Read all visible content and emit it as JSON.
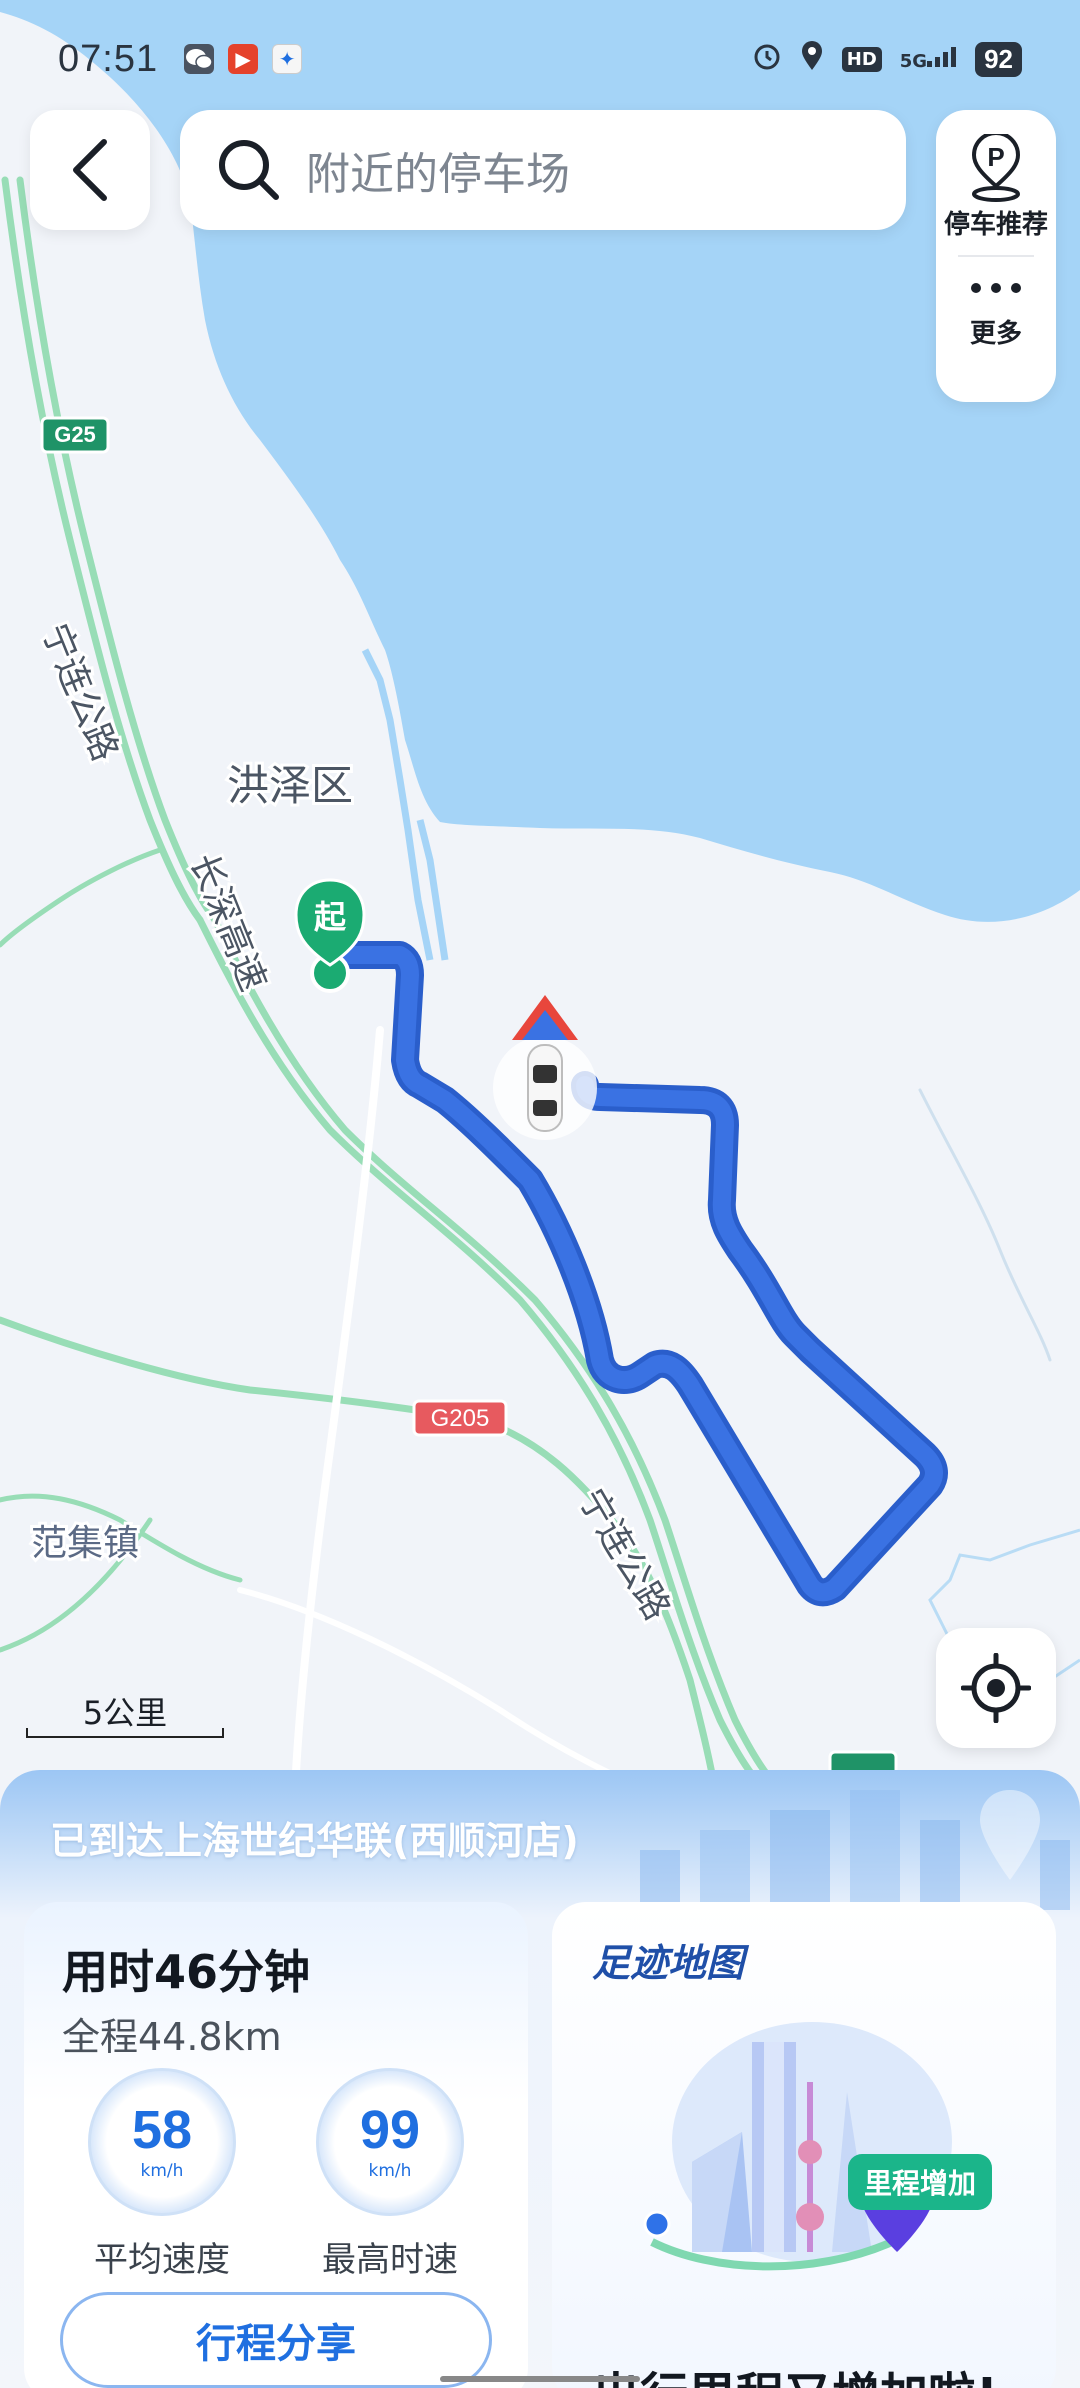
{
  "status_bar": {
    "time": "07:51",
    "hd": "HD",
    "network": "5G",
    "battery": "92"
  },
  "search": {
    "placeholder": "附近的停车场"
  },
  "right_panel": {
    "parking_label": "停车推荐",
    "more_label": "更多"
  },
  "map": {
    "labels": {
      "district": "洪泽区",
      "town": "范集镇",
      "road_ninglian_1": "宁连公路",
      "road_changshen": "长深高速",
      "road_ninglian_2": "宁连公路"
    },
    "shields": {
      "g25": "G25",
      "g205": "G205",
      "bottom": "G205"
    },
    "start_marker": "起",
    "scale_label": "5公里"
  },
  "trip": {
    "arrival_text": "已到达上海世纪华联(西顺河店)",
    "duration": "用时46分钟",
    "distance": "全程44.8km",
    "avg_speed": "58",
    "avg_speed_unit": "km/h",
    "avg_speed_label": "平均速度",
    "max_speed": "99",
    "max_speed_unit": "km/h",
    "max_speed_label": "最高时速",
    "share_button": "行程分享"
  },
  "footprint": {
    "title": "足迹地图",
    "badge": "里程增加",
    "bottom_text": "出行里程又增加啦!"
  },
  "colors": {
    "water": "#a5d4f7",
    "land": "#f1f4f9",
    "route": "#3a72e3",
    "road": "#98ddb6",
    "accent": "#1f6fe0",
    "start_marker": "#1bab72"
  }
}
